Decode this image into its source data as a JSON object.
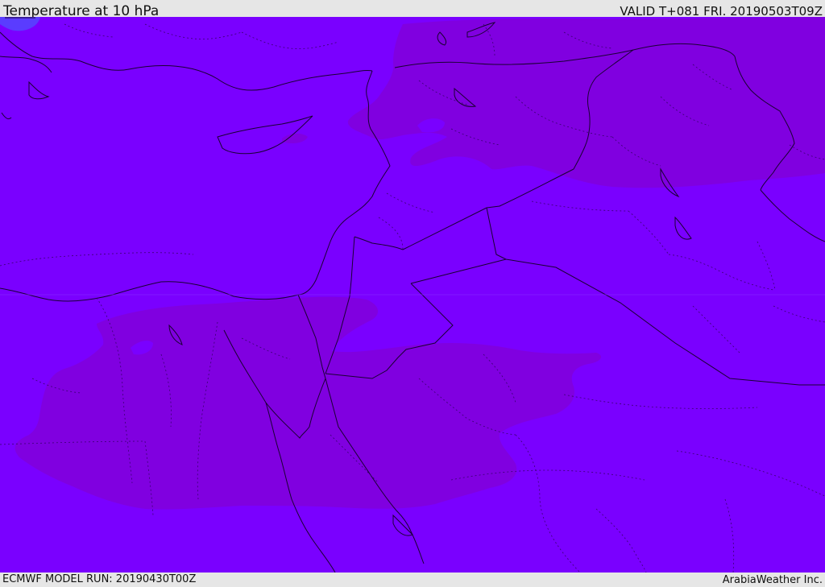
{
  "header": {
    "title": "Temperature at 10 hPa",
    "valid": "VALID T+081 FRI. 20190503T09Z"
  },
  "footer": {
    "model_run": "ECMWF MODEL RUN: 20190430T00Z",
    "credit": "ArabiaWeather Inc."
  },
  "map": {
    "field_colors": {
      "base": "#7a00ff",
      "warmer_band": "#8000e0",
      "cool_spot": "#5a3cff"
    },
    "line_colors": {
      "coast_and_border": "#1a0033",
      "internal_boundary": "#3a0070"
    }
  }
}
